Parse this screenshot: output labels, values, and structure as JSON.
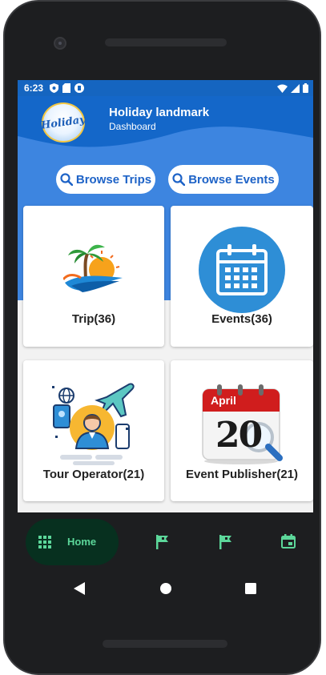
{
  "status_bar": {
    "time": "6:23"
  },
  "header": {
    "logo_text": "Holiday",
    "title": "Holiday landmark",
    "subtitle": "Dashboard"
  },
  "browse": {
    "trips_label": "Browse Trips",
    "events_label": "Browse Events"
  },
  "cards": [
    {
      "label": "Trip(36)",
      "icon": "beach-palm-icon"
    },
    {
      "label": "Events(36)",
      "icon": "calendar-icon"
    },
    {
      "label": "Tour Operator(21)",
      "icon": "tour-operator-icon"
    },
    {
      "label": "Event Publisher(21)",
      "icon": "calendar-april-search-icon",
      "calendar_month": "April",
      "calendar_day": "20"
    }
  ],
  "bottom_nav": {
    "items": [
      {
        "label": "Home",
        "icon": "grid-icon",
        "active": true
      },
      {
        "label": "",
        "icon": "flag-icon"
      },
      {
        "label": "",
        "icon": "flag-icon"
      },
      {
        "label": "",
        "icon": "event-icon"
      }
    ]
  },
  "colors": {
    "primary": "#1565c0",
    "hero": "#3d85e0",
    "accent_green": "#5cd79a",
    "pill_bg": "#07301f"
  }
}
